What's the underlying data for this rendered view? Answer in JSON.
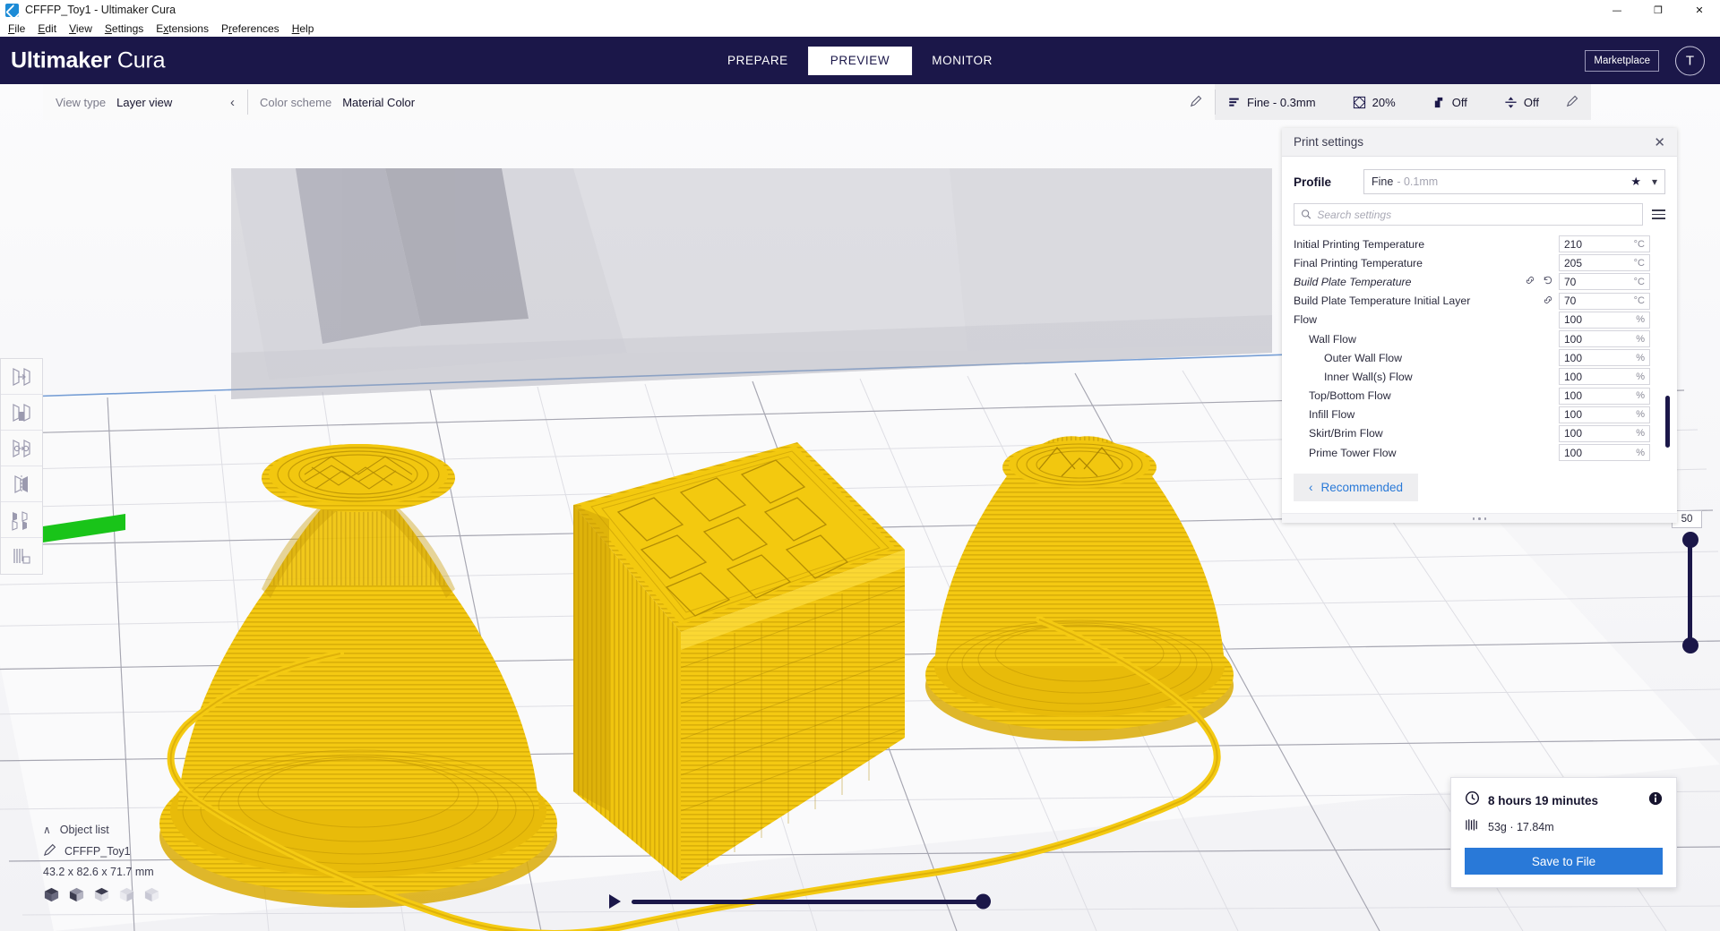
{
  "window": {
    "title": "CFFFP_Toy1 - Ultimaker Cura",
    "minimize": "—",
    "maximize": "❐",
    "close": "✕"
  },
  "menubar": {
    "items": [
      "File",
      "Edit",
      "View",
      "Settings",
      "Extensions",
      "Preferences",
      "Help"
    ]
  },
  "header": {
    "brand_bold": "Ultimaker",
    "brand_light": "Cura",
    "stages": [
      {
        "label": "PREPARE",
        "active": false
      },
      {
        "label": "PREVIEW",
        "active": true
      },
      {
        "label": "MONITOR",
        "active": false
      }
    ],
    "marketplace": "Marketplace",
    "avatar_initial": "T"
  },
  "viewbar": {
    "view_type_label": "View type",
    "view_type_value": "Layer view",
    "collapse_caret": "‹",
    "color_scheme_label": "Color scheme",
    "color_scheme_value": "Material Color",
    "setup_quality": "Fine - 0.3mm",
    "setup_infill": "20%",
    "setup_support": "Off",
    "setup_adhesion": "Off"
  },
  "panel": {
    "title": "Print settings",
    "close": "✕",
    "profile_label": "Profile",
    "profile_value": "Fine",
    "profile_sub": "- 0.1mm",
    "search_placeholder": "Search settings",
    "recommended_label": "Recommended",
    "recommended_caret": "‹",
    "settings": [
      {
        "name": "Initial Printing Temperature",
        "value": "210",
        "unit": "°C",
        "indent": 0,
        "modified": false,
        "linked": false,
        "revert": false
      },
      {
        "name": "Final Printing Temperature",
        "value": "205",
        "unit": "°C",
        "indent": 0,
        "modified": false,
        "linked": false,
        "revert": false
      },
      {
        "name": "Build Plate Temperature",
        "value": "70",
        "unit": "°C",
        "indent": 0,
        "modified": true,
        "linked": true,
        "revert": true
      },
      {
        "name": "Build Plate Temperature Initial Layer",
        "value": "70",
        "unit": "°C",
        "indent": 0,
        "modified": false,
        "linked": true,
        "revert": false
      },
      {
        "name": "Flow",
        "value": "100",
        "unit": "%",
        "indent": 0,
        "modified": false,
        "linked": false,
        "revert": false
      },
      {
        "name": "Wall Flow",
        "value": "100",
        "unit": "%",
        "indent": 1,
        "modified": false,
        "linked": false,
        "revert": false
      },
      {
        "name": "Outer Wall Flow",
        "value": "100",
        "unit": "%",
        "indent": 2,
        "modified": false,
        "linked": false,
        "revert": false
      },
      {
        "name": "Inner Wall(s) Flow",
        "value": "100",
        "unit": "%",
        "indent": 2,
        "modified": false,
        "linked": false,
        "revert": false
      },
      {
        "name": "Top/Bottom Flow",
        "value": "100",
        "unit": "%",
        "indent": 1,
        "modified": false,
        "linked": false,
        "revert": false
      },
      {
        "name": "Infill Flow",
        "value": "100",
        "unit": "%",
        "indent": 1,
        "modified": false,
        "linked": false,
        "revert": false
      },
      {
        "name": "Skirt/Brim Flow",
        "value": "100",
        "unit": "%",
        "indent": 1,
        "modified": false,
        "linked": false,
        "revert": false
      },
      {
        "name": "Prime Tower Flow",
        "value": "100",
        "unit": "%",
        "indent": 1,
        "modified": false,
        "linked": false,
        "revert": false
      }
    ]
  },
  "objectlist": {
    "header": "Object list",
    "chevron": "∧",
    "object_name": "CFFFP_Toy1",
    "dimensions": "43.2 x 82.6 x 71.7 mm"
  },
  "layer_slider": {
    "value": "50"
  },
  "infocard": {
    "time": "8 hours 19 minutes",
    "material": "53g · 17.84m",
    "save_label": "Save to File"
  },
  "colors": {
    "header_blue": "#1b1749",
    "accent_blue": "#2979d8",
    "model_yellow": "#f5cd16"
  }
}
